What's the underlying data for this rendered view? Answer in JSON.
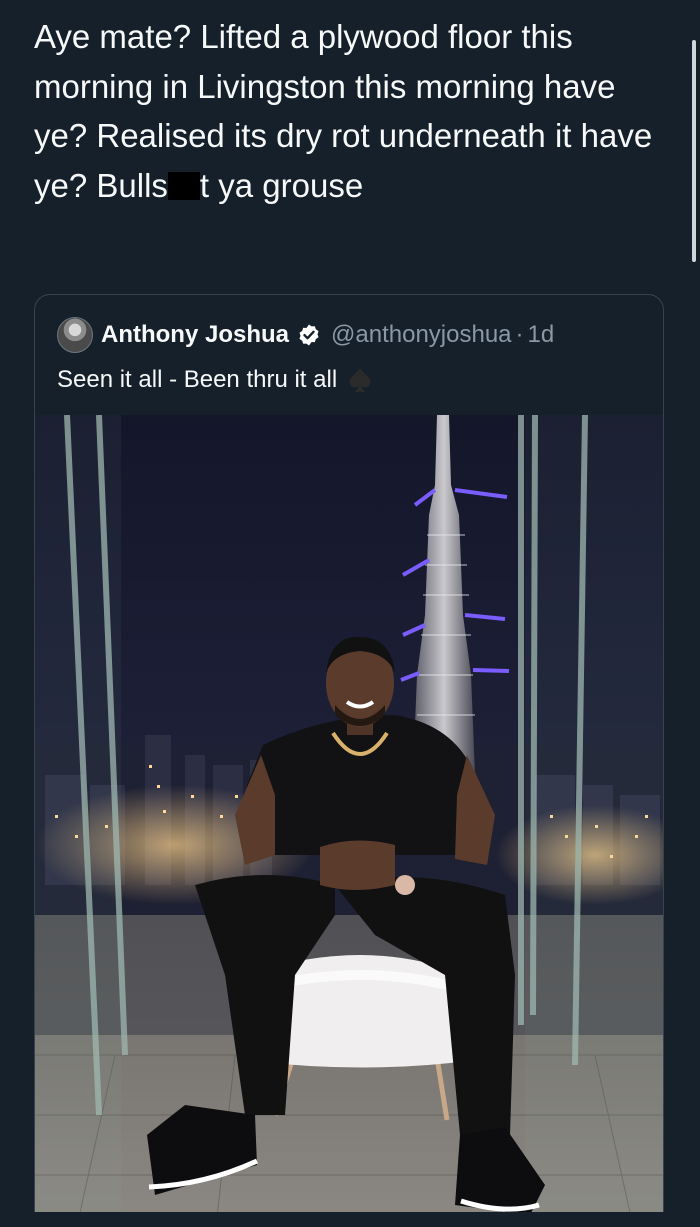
{
  "tweet": {
    "text_before": "Aye mate? Lifted a plywood floor this morning in Livingston this morning have ye? Realised its dry rot underneath it have ye? Bulls",
    "text_after": "t ya grouse"
  },
  "quoted_tweet": {
    "display_name": "Anthony Joshua",
    "handle": "@anthonyjoshua",
    "separator": "·",
    "time": "1d",
    "text": "Seen it all - Been thru it all"
  },
  "icons": {
    "verified": "verified-badge-icon",
    "emoji": "spade-icon",
    "avatar": "user-avatar"
  },
  "colors": {
    "background": "#15202b",
    "text": "#f7f9f9",
    "secondary_text": "#8b98a5",
    "border": "#38444d",
    "verified_badge": "#ffffff"
  }
}
